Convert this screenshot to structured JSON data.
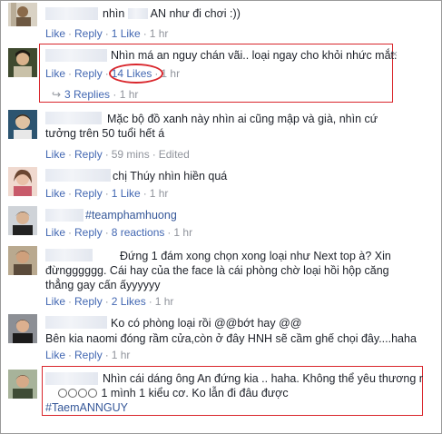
{
  "comments": [
    {
      "text": "nhìn      AN như đi chơi :))",
      "text_a": "nhìn",
      "text_b": "AN như đi chơi :))",
      "like": "Like",
      "reply": "Reply",
      "likes": "1 Like",
      "time": "1 hr"
    },
    {
      "text": "Nhìn má an nguy chán vãi.. loại ngay cho khỏi nhức mắt...",
      "like": "Like",
      "reply": "Reply",
      "likes": "14 Likes",
      "time": "1 hr",
      "replies_label": "3 Replies",
      "replies_time": "1 hr"
    },
    {
      "text": "Mặc bộ đồ xanh này nhìn ai cũng mập và già, nhìn cứ tưởng trên 50 tuổi hết á",
      "like": "Like",
      "reply": "Reply",
      "time": "59 mins",
      "edited": "Edited"
    },
    {
      "text": "chị Thúy nhìn hiền quá",
      "like": "Like",
      "reply": "Reply",
      "likes": "1 Like",
      "time": "1 hr"
    },
    {
      "text": "#teamphamhuong",
      "like": "Like",
      "reply": "Reply",
      "likes": "8 reactions",
      "time": "1 hr"
    },
    {
      "text": "Đứng 1 đám xong chọn xong loại như Next top à? Xin đừngggggg. Cái hay của the face là cái phòng chờ loại hồi hộp căng thẳng gay cấn ấyyyyyy",
      "like": "Like",
      "reply": "Reply",
      "likes": "2 Likes",
      "time": "1 hr"
    },
    {
      "text": "Ko có phòng loại rồi @@bớt hay @@",
      "text2": "Bên kia naomi đóng rầm cửa,còn ở đây HNH sẽ cầm ghế chọi đây....haha",
      "like": "Like",
      "reply": "Reply",
      "time": "1 hr"
    },
    {
      "text": "Nhìn cái dáng ông An đứng kia .. haha. Không thể yêu thương nổi mà.",
      "text2": " 1 mình 1 kiểu cơ. Ko lẫn đi đâu được",
      "hashtag": "#TaemANNGUY"
    }
  ],
  "close_glyph": "×",
  "colors": {
    "link": "#4267b2",
    "meta": "#90949c",
    "highlight": "#d9262c"
  }
}
